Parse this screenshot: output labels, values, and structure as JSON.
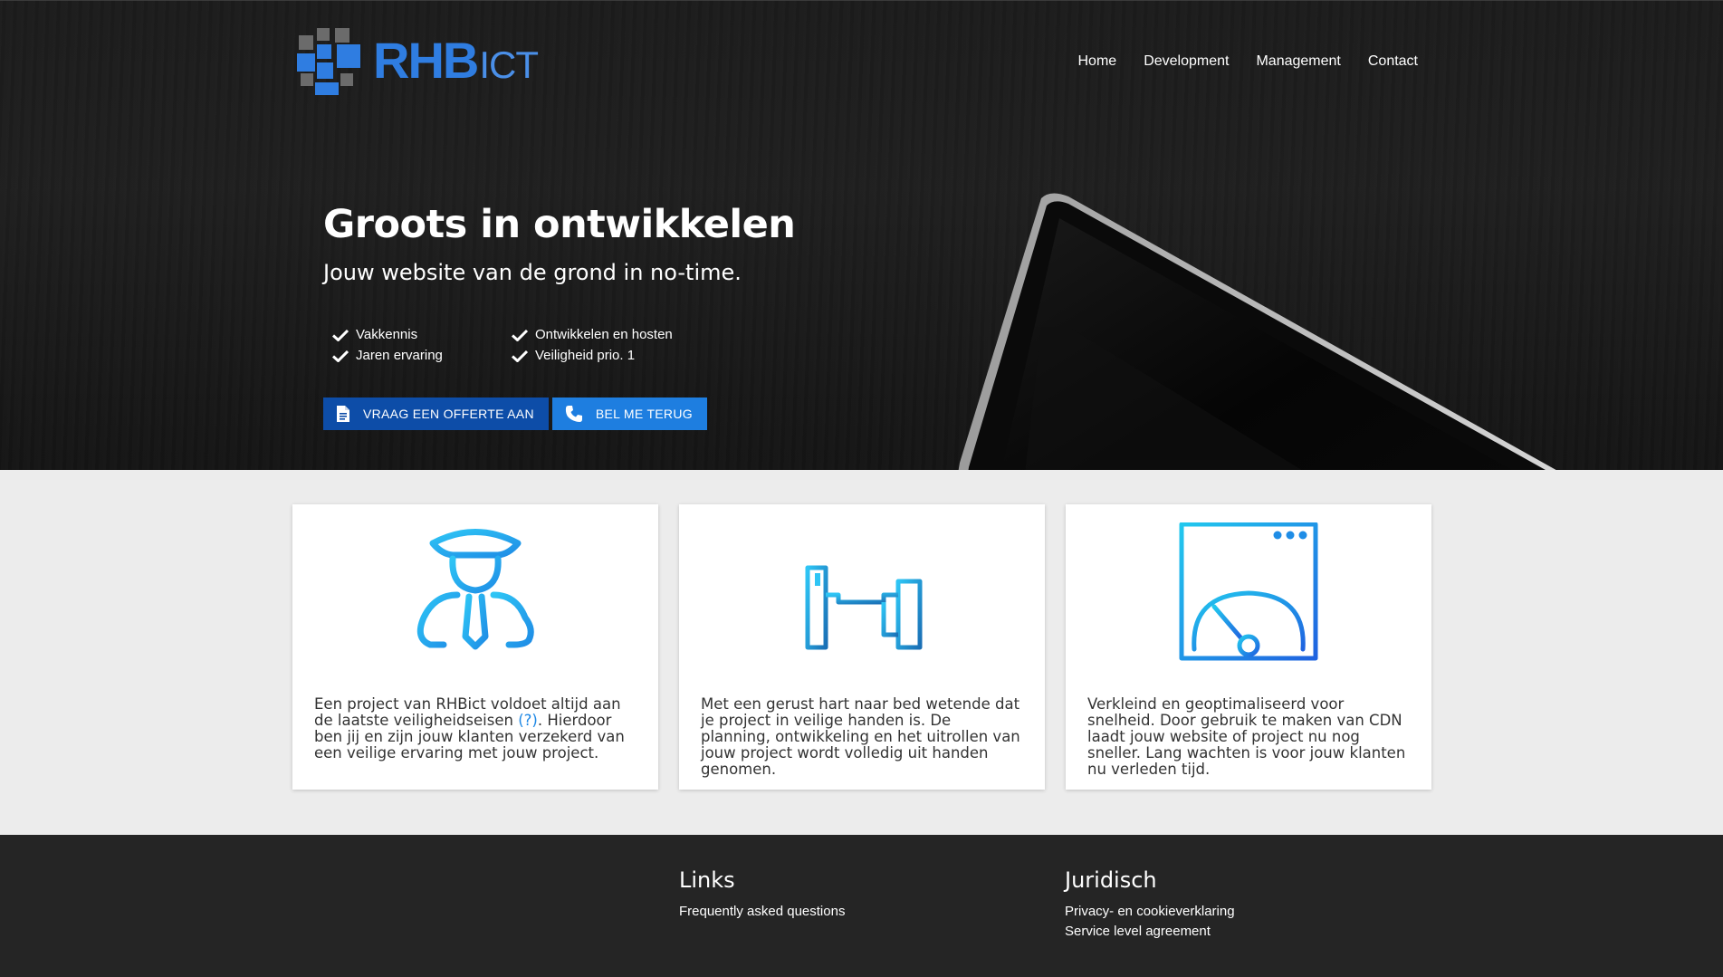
{
  "brand": {
    "logo_rhb": "RHB",
    "logo_ict": "ICT",
    "colors": {
      "primary": "#0d4da8",
      "accent": "#1e7ee0",
      "logo_blue": "#2f7de1",
      "logo_grey": "#6b6b6b"
    }
  },
  "nav": {
    "items": [
      {
        "label": "Home"
      },
      {
        "label": "Development"
      },
      {
        "label": "Management"
      },
      {
        "label": "Contact"
      }
    ]
  },
  "hero": {
    "title": "Groots in ontwikkelen",
    "subtitle": "Jouw website van de grond in no-time.",
    "features": [
      {
        "label": "Vakkennis",
        "icon": "check-icon"
      },
      {
        "label": "Ontwikkelen en hosten",
        "icon": "check-icon"
      },
      {
        "label": "Jaren ervaring",
        "icon": "check-icon"
      },
      {
        "label": "Veiligheid prio. 1",
        "icon": "check-icon"
      }
    ],
    "quote_button": {
      "label": "VRAAG EEN OFFERTE AAN",
      "icon": "document-icon"
    },
    "callback_button": {
      "label": "BEL ME TERUG",
      "icon": "phone-icon"
    }
  },
  "cards": [
    {
      "icon": "security-guard-icon",
      "text_before": "Een project van RHBict voldoet altijd aan de laatste veiligheidseisen ",
      "link": "(?)",
      "text_after": ". Hierdoor ben jij en zijn jouw klanten verzekerd van een veilige ervaring met jouw project."
    },
    {
      "icon": "bed-icon",
      "text": "Met een gerust hart naar bed wetende dat je project in veilige handen is. De planning, ontwikkeling en het uitrollen van jouw project wordt volledig uit handen genomen."
    },
    {
      "icon": "speed-gauge-icon",
      "text": "Verkleind en geoptimaliseerd voor snelheid. Door gebruik te maken van CDN laadt jouw website of project nu nog sneller. Lang wachten is voor jouw klanten nu verleden tijd."
    }
  ],
  "footer": {
    "links": {
      "heading": "Links",
      "items": [
        "Frequently asked questions"
      ]
    },
    "legal": {
      "heading": "Juridisch",
      "items": [
        "Privacy- en cookieverklaring",
        "Service level agreement"
      ]
    }
  }
}
